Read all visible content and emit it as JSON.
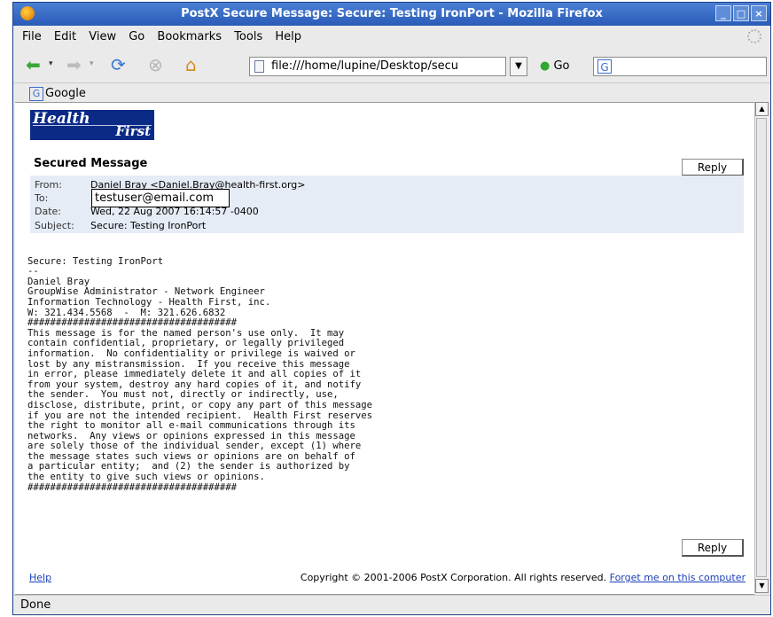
{
  "window": {
    "title": "PostX Secure Message: Secure: Testing IronPort - Mozilla Firefox",
    "buttons": [
      "_",
      "□",
      "×"
    ]
  },
  "menu": [
    "File",
    "Edit",
    "View",
    "Go",
    "Bookmarks",
    "Tools",
    "Help"
  ],
  "nav": {
    "url": "file:///home/lupine/Desktop/secu",
    "go_label": "Go",
    "search_value": ""
  },
  "bookmarks": {
    "google_icon": "G",
    "google_label": "Google"
  },
  "page": {
    "logo_line1": "Health",
    "logo_line2": "First",
    "heading": "Secured Message",
    "reply_label": "Reply",
    "headers": {
      "from_key": "From:",
      "from_value": "Daniel Bray <Daniel.Bray@health-first.org>",
      "to_key": "To:",
      "to_value": "",
      "date_key": "Date:",
      "date_value": "Wed, 22 Aug 2007 16:14:57 -0400",
      "subject_key": "Subject:",
      "subject_value": "Secure: Testing IronPort"
    },
    "to_overlay": "testuser@email.com",
    "body": [
      "Secure: Testing IronPort",
      "--",
      "",
      "",
      "Daniel Bray",
      "GroupWise Administrator - Network Engineer",
      "Information Technology - Health First, inc.",
      "W: 321.434.5568  -  M: 321.626.6832",
      "",
      "",
      "#####################################",
      "This message is for the named person's use only.  It may",
      "contain confidential, proprietary, or legally privileged",
      "information.  No confidentiality or privilege is waived or",
      "lost by any mistransmission.  If you receive this message",
      "in error, please immediately delete it and all copies of it",
      "from your system, destroy any hard copies of it, and notify",
      "the sender.  You must not, directly or indirectly, use,",
      "disclose, distribute, print, or copy any part of this message",
      "if you are not the intended recipient.  Health First reserves",
      "the right to monitor all e-mail communications through its",
      "networks.  Any views or opinions expressed in this message",
      "are solely those of the individual sender, except (1) where",
      "the message states such views or opinions are on behalf of",
      "a particular entity;  and (2) the sender is authorized by",
      "the entity to give such views or opinions.",
      "#####################################"
    ],
    "footer": {
      "help_label": "Help",
      "copyright": "Copyright © 2001-2006 PostX Corporation. All rights reserved.",
      "forget_label": "Forget me on this computer"
    }
  },
  "status": "Done"
}
